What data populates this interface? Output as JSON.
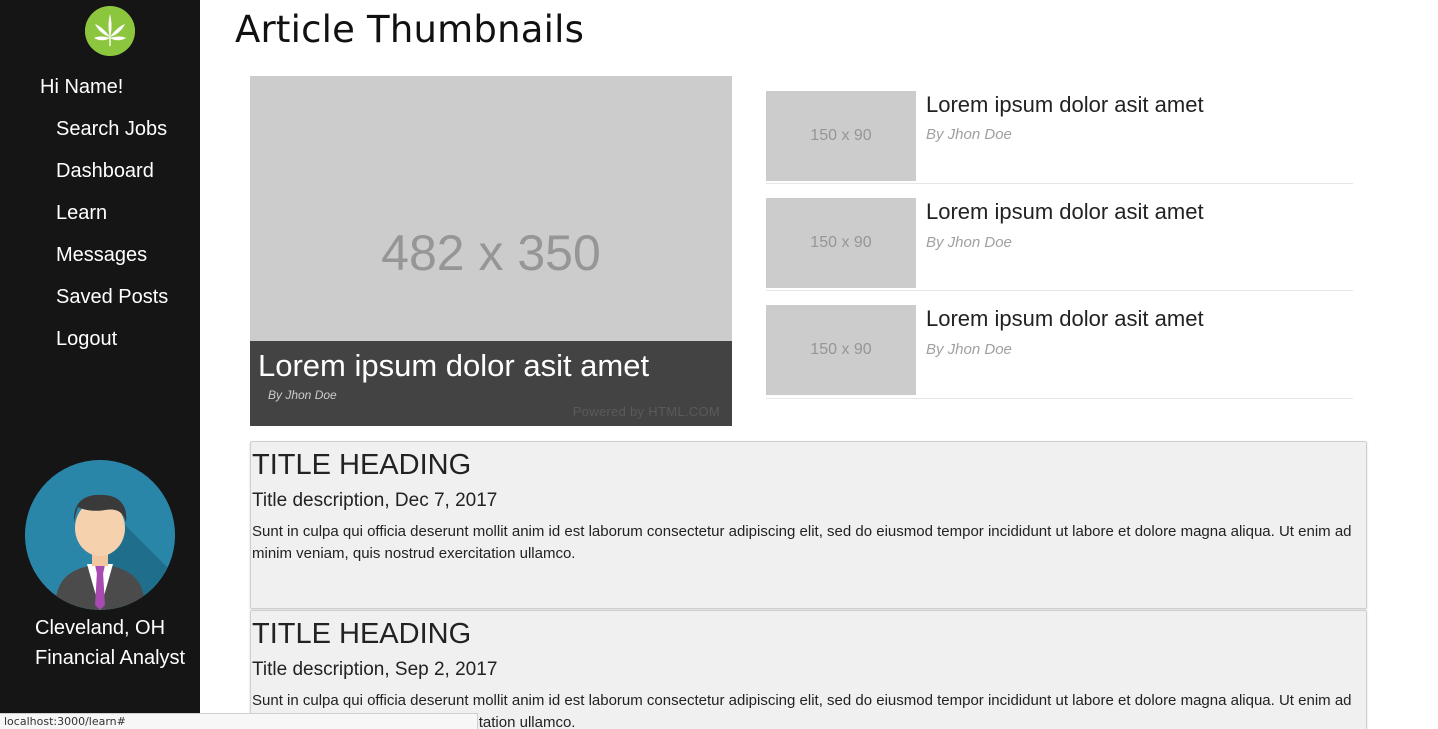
{
  "sidebar": {
    "logo_icon": "cannabis-leaf-icon",
    "greeting": "Hi Name!",
    "nav": [
      "Search Jobs",
      "Dashboard",
      "Learn",
      "Messages",
      "Saved Posts",
      "Logout"
    ],
    "avatar_icon": "user-avatar-icon",
    "location": "Cleveland, OH",
    "job_title": "Financial Analyst"
  },
  "page": {
    "title": "Article Thumbnails"
  },
  "featured": {
    "placeholder": "482 x 350",
    "title": "Lorem ipsum dolor asit amet",
    "author": "By Jhon Doe",
    "powered_by": "Powered by HTML.COM"
  },
  "side_articles": [
    {
      "placeholder": "150 x 90",
      "title": "Lorem ipsum dolor asit amet",
      "author": "By Jhon Doe"
    },
    {
      "placeholder": "150 x 90",
      "title": "Lorem ipsum dolor asit amet",
      "author": "By Jhon Doe"
    },
    {
      "placeholder": "150 x 90",
      "title": "Lorem ipsum dolor asit amet",
      "author": "By Jhon Doe"
    }
  ],
  "posts": [
    {
      "heading": "TITLE HEADING",
      "description": "Title description, Dec 7, 2017",
      "body": "Sunt in culpa qui officia deserunt mollit anim id est laborum consectetur adipiscing elit, sed do eiusmod tempor incididunt ut labore et dolore magna aliqua. Ut enim ad minim veniam, quis nostrud exercitation ullamco."
    },
    {
      "heading": "TITLE HEADING",
      "description": "Title description, Sep 2, 2017",
      "body": "Sunt in culpa qui officia deserunt mollit anim id est laborum consectetur adipiscing elit, sed do eiusmod tempor incididunt ut labore et dolore magna aliqua. Ut enim ad minim veniam, quis nostrud exercitation ullamco."
    }
  ],
  "status_bar": {
    "url": "localhost:3000/learn#"
  },
  "colors": {
    "sidebar_bg": "#151515",
    "logo_green": "#8cc63f",
    "placeholder_bg": "#cccccc",
    "caption_bg": "#434343",
    "card_bg": "#f0f0f0"
  }
}
